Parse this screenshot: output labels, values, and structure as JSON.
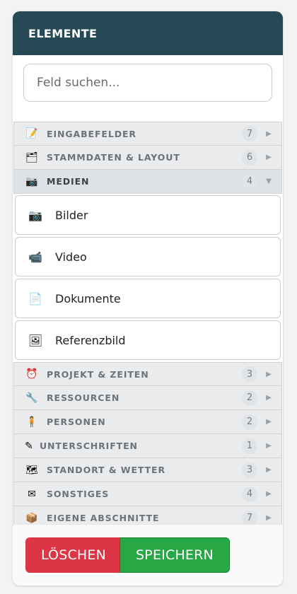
{
  "header": {
    "title": "ELEMENTE"
  },
  "search": {
    "placeholder": "Feld suchen..."
  },
  "categories_top": [
    {
      "label": "EINGABEFELDER",
      "count": "7",
      "icon": "memo-icon",
      "glyph": "📝",
      "arrow": "▶"
    },
    {
      "label": "STAMMDATEN & LAYOUT",
      "count": "6",
      "icon": "card-index-icon",
      "glyph": "🗂",
      "arrow": "▶"
    },
    {
      "label": "MEDIEN",
      "count": "4",
      "icon": "camera-icon",
      "glyph": "📷",
      "arrow": "▼"
    }
  ],
  "media_items": [
    {
      "label": "Bilder",
      "icon": "camera-icon",
      "glyph": "📷"
    },
    {
      "label": "Video",
      "icon": "video-camera-icon",
      "glyph": "📹"
    },
    {
      "label": "Dokumente",
      "icon": "document-icon",
      "glyph": "📄"
    },
    {
      "label": "Referenzbild",
      "icon": "framed-picture-icon",
      "glyph": "🖼"
    }
  ],
  "categories_bottom": [
    {
      "label": "PROJEKT & ZEITEN",
      "count": "3",
      "icon": "alarm-clock-icon",
      "glyph": "⏰",
      "arrow": "▶"
    },
    {
      "label": "RESSOURCEN",
      "count": "2",
      "icon": "wrench-icon",
      "glyph": "🔧",
      "arrow": "▶"
    },
    {
      "label": "PERSONEN",
      "count": "2",
      "icon": "person-icon",
      "glyph": "🧍",
      "arrow": "▶"
    },
    {
      "label": "UNTERSCHRIFTEN",
      "count": "1",
      "icon": "pencil-icon",
      "glyph": "✎",
      "arrow": "▶"
    },
    {
      "label": "STANDORT & WETTER",
      "count": "3",
      "icon": "map-icon",
      "glyph": "🗺",
      "arrow": "▶"
    },
    {
      "label": "SONSTIGES",
      "count": "4",
      "icon": "envelope-icon",
      "glyph": "✉",
      "arrow": "▶"
    },
    {
      "label": "EIGENE ABSCHNITTE",
      "count": "7",
      "icon": "package-icon",
      "glyph": "📦",
      "arrow": "▶"
    }
  ],
  "footer": {
    "delete_label": "LÖSCHEN",
    "save_label": "SPEICHERN"
  },
  "colors": {
    "header": "#254a56",
    "delete": "#dc3545",
    "save": "#28a745"
  }
}
